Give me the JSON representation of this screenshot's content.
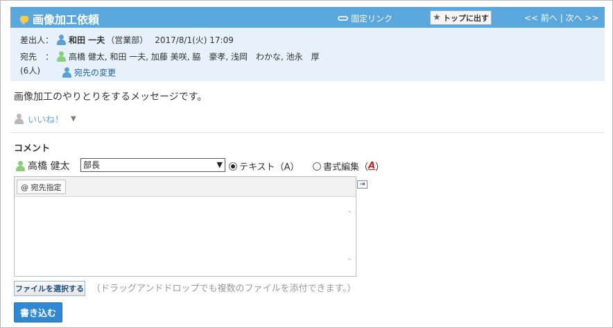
{
  "header": {
    "title": "画像加工依頼",
    "permalink_label": "固定リンク",
    "top_button_label": "トップに出す",
    "nav_prev": "<< 前へ",
    "nav_sep": "|",
    "nav_next": "次へ >>",
    "colors": {
      "bar": "#5aa7dd",
      "meta_bg": "#e7f1fb"
    }
  },
  "meta": {
    "sender_label": "差出人：",
    "sender_name": "和田 一夫",
    "sender_dept": "（営業部）",
    "sent_at": "2017/8/1(火) 17:09",
    "recipients_label": "宛先　：",
    "recipients_count": "(6人)",
    "recipients": "高橋 健太, 和田 一夫, 加藤 美咲, 脇　豪孝, 浅岡　わかな, 池永　厚",
    "change_recipients": "宛先の変更"
  },
  "message": {
    "body": "画像加工のやりとりをするメッセージです。",
    "like_label": "いいね！",
    "like_menu_icon": "caret-down-icon"
  },
  "comment": {
    "title": "コメント",
    "user_name": "高橋 健太",
    "role_select": {
      "selected": "部長"
    },
    "radio_text": "テキスト（A）",
    "radio_rich_prefix": "書式編集（",
    "radio_rich_a": "A",
    "radio_rich_suffix": "）",
    "mention_button": "@ 宛先指定",
    "file_button": "ファイルを選択する",
    "file_note": "（ドラッグアンドドロップでも複数のファイルを添付できます。）",
    "submit_label": "書き込む"
  }
}
